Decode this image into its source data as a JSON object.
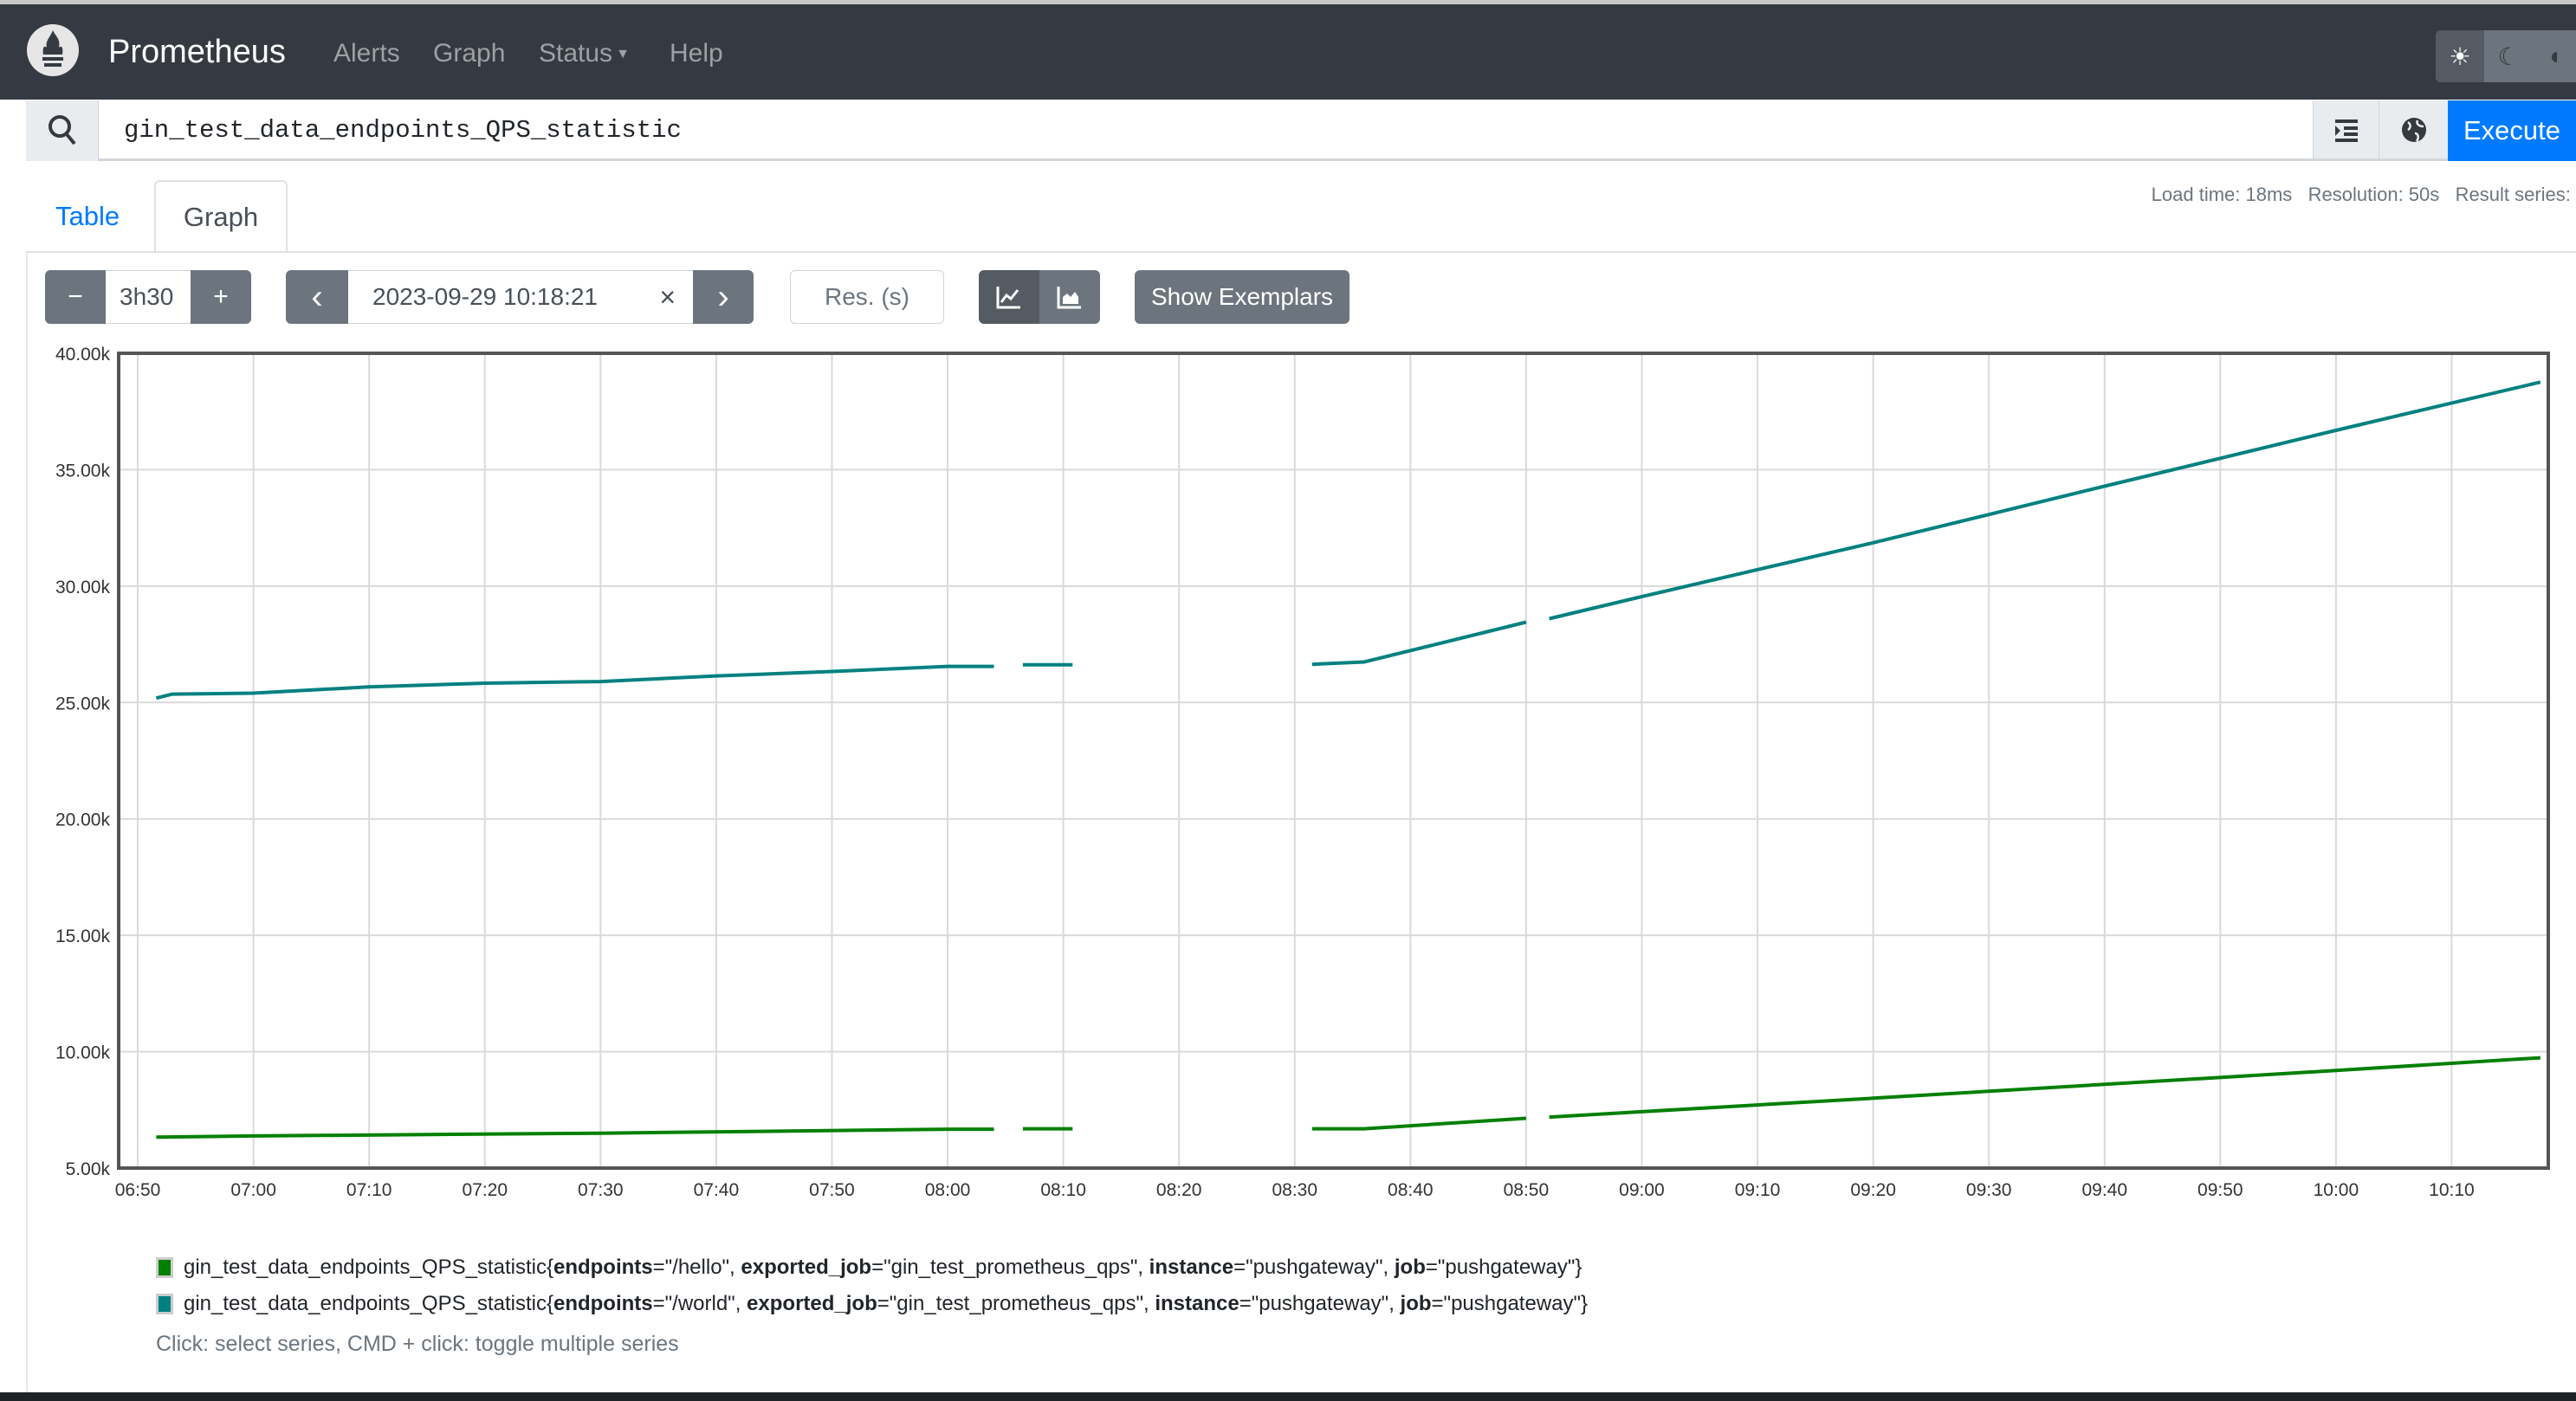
{
  "navbar": {
    "brand": "Prometheus",
    "links": [
      "Alerts",
      "Graph",
      "Status",
      "Help"
    ],
    "theme_icons": [
      "sun-icon",
      "moon-icon",
      "contrast-icon"
    ],
    "active_theme": "light"
  },
  "query": {
    "expression": "gin_test_data_endpoints_QPS_statistic",
    "execute_label": "Execute"
  },
  "tabs": {
    "table": "Table",
    "graph": "Graph",
    "active": "Graph"
  },
  "stats": {
    "text": "Load time: 18ms   Resolution: 50s   Result series: "
  },
  "controls": {
    "range": "3h30",
    "end_time": "2023-09-29 10:18:21",
    "clear": "×",
    "resolution_placeholder": "Res. (s)",
    "exemplars_label": "Show Exemplars",
    "minus": "−",
    "plus": "+",
    "prev": "‹",
    "next": "›",
    "chart_mode": "line"
  },
  "colors": {
    "hello": "#008000",
    "world": "#008080",
    "accent": "#007bff"
  },
  "chart_data": {
    "type": "line",
    "ylim": [
      5000,
      40000
    ],
    "xlim": [
      "06:48:21",
      "10:18:21"
    ],
    "yticks": [
      "5.00k",
      "10.00k",
      "15.00k",
      "20.00k",
      "25.00k",
      "30.00k",
      "35.00k",
      "40.00k"
    ],
    "xticks": [
      "06:50",
      "07:00",
      "07:10",
      "07:20",
      "07:30",
      "07:40",
      "07:50",
      "08:00",
      "08:10",
      "08:20",
      "08:30",
      "08:40",
      "08:50",
      "09:00",
      "09:10",
      "09:20",
      "09:30",
      "09:40",
      "09:50",
      "10:00",
      "10:10"
    ],
    "grid": true,
    "series": [
      {
        "name": "gin_test_data_endpoints_QPS_statistic{endpoints=\"/hello\", exported_job=\"gin_test_prometheus_qps\", instance=\"pushgateway\", job=\"pushgateway\"}",
        "color": "#008000",
        "segments": [
          [
            [
              "06:51:36",
              6330
            ],
            [
              "07:00",
              6380
            ],
            [
              "07:30",
              6500
            ],
            [
              "08:00",
              6670
            ],
            [
              "08:04",
              6670
            ]
          ],
          [
            [
              "08:06:30",
              6690
            ],
            [
              "08:10:48",
              6690
            ]
          ],
          [
            [
              "08:31:30",
              6690
            ],
            [
              "08:36",
              6690
            ],
            [
              "08:50",
              7140
            ]
          ],
          [
            [
              "08:52",
              7190
            ],
            [
              "09:20",
              8000
            ],
            [
              "10:00",
              9190
            ],
            [
              "10:17:40",
              9740
            ]
          ]
        ]
      },
      {
        "name": "gin_test_data_endpoints_QPS_statistic{endpoints=\"/world\", exported_job=\"gin_test_prometheus_qps\", instance=\"pushgateway\", job=\"pushgateway\"}",
        "color": "#008080",
        "segments": [
          [
            [
              "06:51:36",
              25190
            ],
            [
              "06:53",
              25360
            ],
            [
              "07:00",
              25400
            ],
            [
              "07:10",
              25670
            ],
            [
              "07:20",
              25830
            ],
            [
              "07:30",
              25900
            ],
            [
              "07:40",
              26140
            ],
            [
              "07:50",
              26330
            ],
            [
              "08:00",
              26550
            ],
            [
              "08:04",
              26550
            ]
          ],
          [
            [
              "08:06:30",
              26620
            ],
            [
              "08:10:48",
              26620
            ]
          ],
          [
            [
              "08:31:30",
              26640
            ],
            [
              "08:36",
              26740
            ],
            [
              "08:50",
              28450
            ]
          ],
          [
            [
              "08:52",
              28600
            ],
            [
              "09:00",
              29550
            ],
            [
              "09:20",
              31860
            ],
            [
              "09:40",
              34290
            ],
            [
              "10:00",
              36690
            ],
            [
              "10:17:40",
              38760
            ]
          ]
        ]
      }
    ]
  },
  "legend": {
    "items": [
      {
        "metric": "gin_test_data_endpoints_QPS_statistic{",
        "labels": [
          [
            "endpoints",
            "=\"/hello\", "
          ],
          [
            "exported_job",
            "=\"gin_test_prometheus_qps\", "
          ],
          [
            "instance",
            "=\"pushgateway\", "
          ],
          [
            "job",
            "=\"pushgateway\"}"
          ]
        ]
      },
      {
        "metric": "gin_test_data_endpoints_QPS_statistic{",
        "labels": [
          [
            "endpoints",
            "=\"/world\", "
          ],
          [
            "exported_job",
            "=\"gin_test_prometheus_qps\", "
          ],
          [
            "instance",
            "=\"pushgateway\", "
          ],
          [
            "job",
            "=\"pushgateway\"}"
          ]
        ]
      }
    ],
    "hint": "Click: select series, CMD + click: toggle multiple series"
  }
}
